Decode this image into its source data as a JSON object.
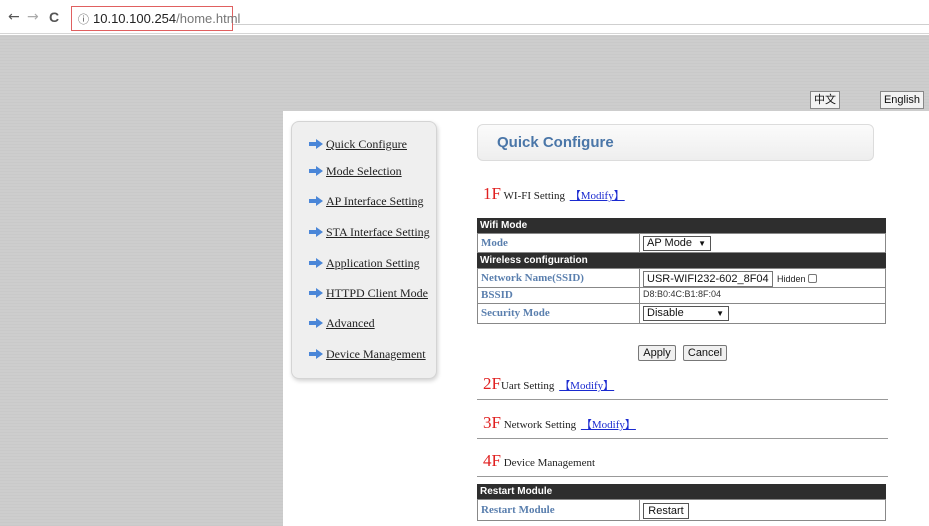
{
  "browser": {
    "url_host": "10.10.100.254",
    "url_path": "/home.html",
    "back": "←",
    "forward": "→",
    "reload": "C",
    "info_icon": "ⓘ"
  },
  "lang": {
    "chinese": "中文",
    "english": "English"
  },
  "sidebar": {
    "items": [
      {
        "label": "Quick Configure"
      },
      {
        "label": "Mode Selection"
      },
      {
        "label": "AP Interface Setting"
      },
      {
        "label": "STA Interface Setting"
      },
      {
        "label": "Application Setting"
      },
      {
        "label": "HTTPD Client Mode"
      },
      {
        "label": "Advanced"
      },
      {
        "label": "Device Management"
      }
    ]
  },
  "main": {
    "title": "Quick Configure",
    "modify_label": "【Modify】",
    "sections": [
      {
        "num": "1F",
        "label": "WI-FI Setting"
      },
      {
        "num": "2F",
        "label": "Uart Setting"
      },
      {
        "num": "3F",
        "label": "Network Setting"
      },
      {
        "num": "4F",
        "label": "Device Management"
      }
    ],
    "wifi_table": {
      "header1": "Wifi Mode",
      "mode_label": "Mode",
      "mode_value": "AP Mode",
      "header2": "Wireless configuration",
      "ssid_label": "Network Name(SSID)",
      "ssid_value": "USR-WIFI232-602_8F04",
      "hidden_label": "Hidden",
      "bssid_label": "BSSID",
      "bssid_value": "D8:B0:4C:B1:8F:04",
      "security_label": "Security Mode",
      "security_value": "Disable"
    },
    "apply_label": "Apply",
    "cancel_label": "Cancel",
    "restart_table": {
      "header": "Restart Module",
      "label": "Restart Module",
      "button": "Restart"
    }
  }
}
